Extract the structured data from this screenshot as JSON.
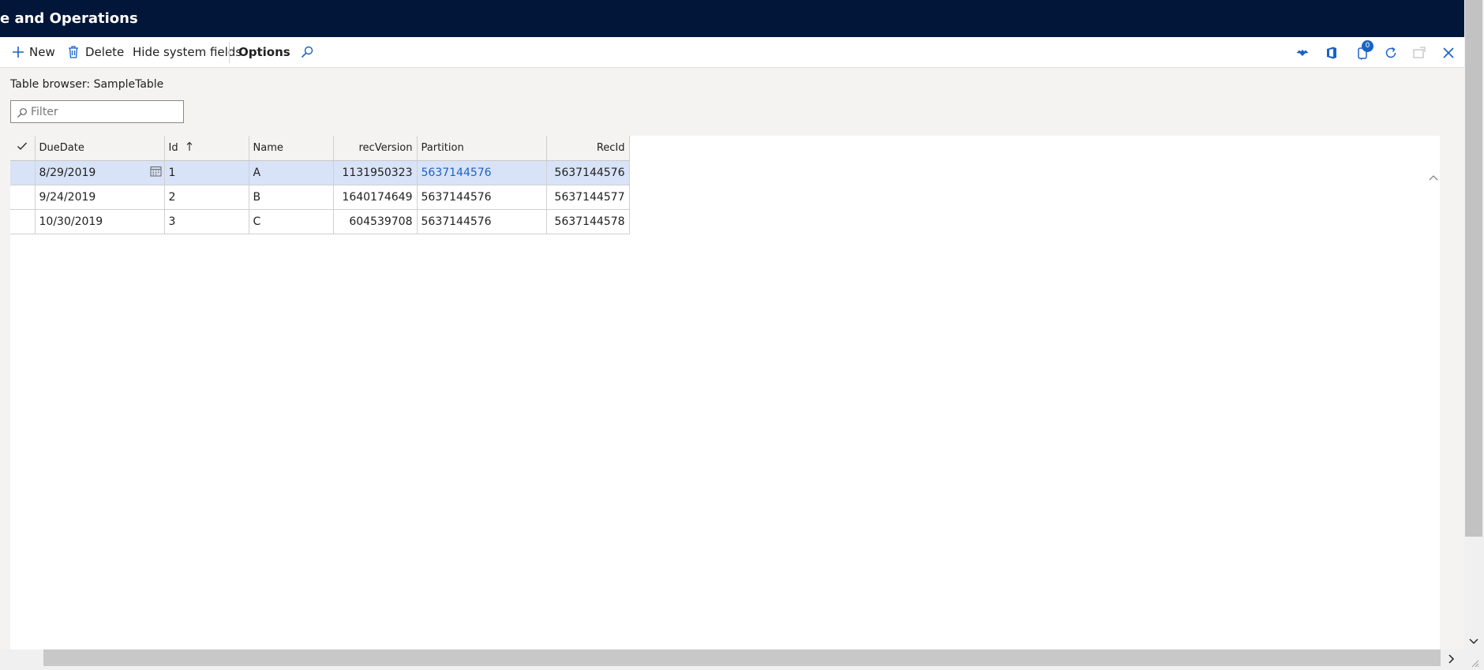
{
  "window": {
    "app_title": "e and Operations"
  },
  "toolbar": {
    "new_label": "New",
    "delete_label": "Delete",
    "hide_system_fields_label": "Hide system fields",
    "options_label": "Options",
    "notifications_count": "0"
  },
  "page": {
    "title": "Table browser: SampleTable"
  },
  "filter": {
    "placeholder": "Filter",
    "value": ""
  },
  "grid": {
    "columns": {
      "due_date": "DueDate",
      "id": "Id",
      "name": "Name",
      "rec_version": "recVersion",
      "partition": "Partition",
      "rec_id": "RecId"
    },
    "rows": [
      {
        "due_date": "8/29/2019",
        "id": "1",
        "name": "A",
        "rec_version": "1131950323",
        "partition": "5637144576",
        "rec_id": "5637144576"
      },
      {
        "due_date": "9/24/2019",
        "id": "2",
        "name": "B",
        "rec_version": "1640174649",
        "partition": "5637144576",
        "rec_id": "5637144577"
      },
      {
        "due_date": "10/30/2019",
        "id": "3",
        "name": "C",
        "rec_version": "604539708",
        "partition": "5637144576",
        "rec_id": "5637144578"
      }
    ],
    "selected_row": 1,
    "sort_column": "Id",
    "sort_direction": "ascending"
  },
  "colors": {
    "title_bar": "#011638",
    "accent": "#1a62c6",
    "selected_row": "#d8e3f7",
    "content_background": "#f4f3f2"
  },
  "icons": {
    "new": "plus-icon",
    "delete": "trash-icon",
    "search": "search-icon",
    "power_apps": "diamond-icon",
    "office": "office-icon",
    "notifications": "notification-icon",
    "refresh": "refresh-icon",
    "open_new_window": "popout-icon",
    "close": "close-icon",
    "calendar": "calendar-icon",
    "sort": "sort-arrow-up-icon"
  }
}
